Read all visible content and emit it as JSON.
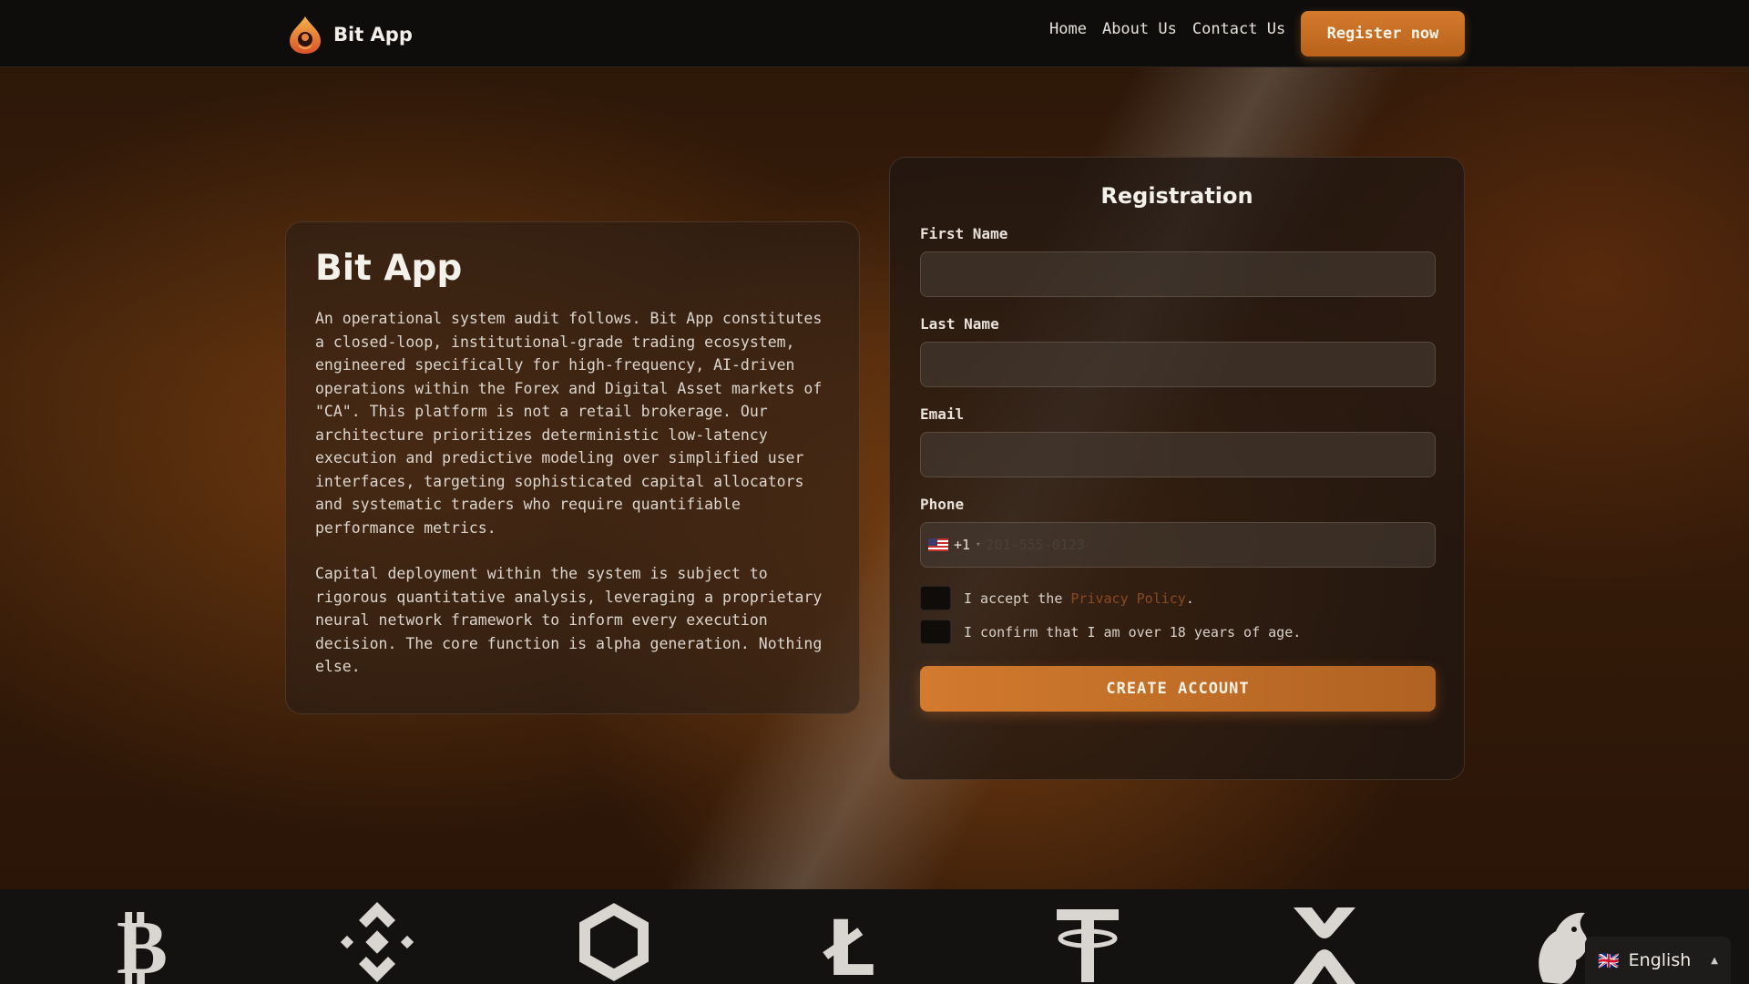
{
  "header": {
    "brand_name": "Bit App",
    "nav": [
      "Home",
      "About Us",
      "Contact Us"
    ],
    "register_label": "Register now"
  },
  "info": {
    "title": "Bit App",
    "paragraphs": [
      "An operational system audit follows. Bit App constitutes a closed-loop, institutional-grade trading ecosystem, engineered specifically for high-frequency, AI-driven operations within the Forex and Digital Asset markets of \"CA\". This platform is not a retail brokerage. Our architecture prioritizes deterministic low-latency execution and predictive modeling over simplified user interfaces, targeting sophisticated capital allocators and systematic traders who require quantifiable performance metrics.",
      "Capital deployment within the system is subject to rigorous quantitative analysis, leveraging a proprietary neural network framework to inform every execution decision. The core function is alpha generation. Nothing else."
    ]
  },
  "registration": {
    "title": "Registration",
    "first_name_label": "First Name",
    "last_name_label": "Last Name",
    "email_label": "Email",
    "phone_label": "Phone",
    "phone_dial_code": "+1",
    "phone_placeholder": "201-555-0123",
    "privacy_prefix": "I accept the ",
    "privacy_link": "Privacy Policy",
    "privacy_suffix": ".",
    "age_confirm": "I confirm that I am over 18 years of age.",
    "submit_label": "CREATE ACCOUNT"
  },
  "crypto_icons": [
    "bitcoin-icon",
    "binance-icon",
    "chainlink-icon",
    "litecoin-icon",
    "tether-icon",
    "xrp-icon",
    "uniswap-icon"
  ],
  "language": {
    "label": "English",
    "flag_text": "🇬🇧"
  },
  "colors": {
    "accent": "#c96f26",
    "link": "#8a4a22",
    "header_bg": "#0e0d0c"
  }
}
